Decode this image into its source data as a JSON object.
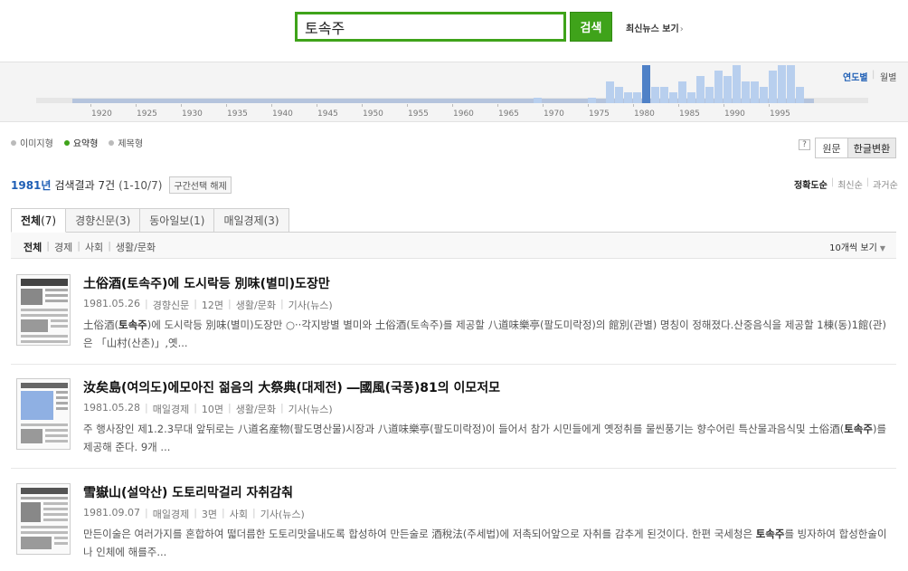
{
  "search": {
    "query": "토속주",
    "button_label": "검색",
    "latest_news_label": "최신뉴스 보기"
  },
  "timeline": {
    "year_toggle": "연도별",
    "month_toggle": "월별",
    "axis_labels": [
      "1920",
      "1925",
      "1930",
      "1935",
      "1940",
      "1945",
      "1950",
      "1955",
      "1960",
      "1965",
      "1970",
      "1975",
      "1980",
      "1985",
      "1990",
      "1995"
    ],
    "selected_year": 1981,
    "bar_color": "#b8cfee",
    "selected_color": "#4f81c7",
    "bars": [
      {
        "year": 1969,
        "value": 1
      },
      {
        "year": 1975,
        "value": 1
      },
      {
        "year": 1977,
        "value": 4
      },
      {
        "year": 1978,
        "value": 3
      },
      {
        "year": 1979,
        "value": 2
      },
      {
        "year": 1980,
        "value": 2
      },
      {
        "year": 1981,
        "value": 7
      },
      {
        "year": 1982,
        "value": 3
      },
      {
        "year": 1983,
        "value": 3
      },
      {
        "year": 1984,
        "value": 2
      },
      {
        "year": 1985,
        "value": 4
      },
      {
        "year": 1986,
        "value": 2
      },
      {
        "year": 1987,
        "value": 5
      },
      {
        "year": 1988,
        "value": 3
      },
      {
        "year": 1989,
        "value": 6
      },
      {
        "year": 1990,
        "value": 5
      },
      {
        "year": 1991,
        "value": 7
      },
      {
        "year": 1992,
        "value": 4
      },
      {
        "year": 1993,
        "value": 4
      },
      {
        "year": 1994,
        "value": 3
      },
      {
        "year": 1995,
        "value": 6
      },
      {
        "year": 1996,
        "value": 7
      },
      {
        "year": 1997,
        "value": 7
      },
      {
        "year": 1998,
        "value": 3
      }
    ]
  },
  "view_options": [
    {
      "label": "이미지형",
      "selected": false
    },
    {
      "label": "요약형",
      "selected": true
    },
    {
      "label": "제목형",
      "selected": false
    }
  ],
  "help_label": "?",
  "text_mode": {
    "original": "원문",
    "hangul": "한글변환"
  },
  "result": {
    "year": "1981년",
    "count_text": "검색결과 7건",
    "range_text": "(1-10/7)",
    "clear_label": "구간선택 해제"
  },
  "sort": {
    "accuracy": "정확도순",
    "newest": "최신순",
    "oldest": "과거순"
  },
  "tabs": [
    {
      "label": "전체",
      "count": "(7)",
      "active": true
    },
    {
      "label": "경향신문",
      "count": "(3)",
      "active": false
    },
    {
      "label": "동아일보",
      "count": "(1)",
      "active": false
    },
    {
      "label": "매일경제",
      "count": "(3)",
      "active": false
    }
  ],
  "subcategories": [
    "전체",
    "경제",
    "사회",
    "생활/문화"
  ],
  "per_page": "10개씩 보기",
  "articles": [
    {
      "title": "土俗酒(토속주)에 도시락등 別味(별미)도장만",
      "date": "1981.05.26",
      "paper": "경향신문",
      "page": "12면",
      "section": "생활/문화",
      "kind": "기사(뉴스)",
      "snippet_pre": "土俗酒(",
      "snippet_kw": "토속주",
      "snippet_post": ")에 도시락등 別味(별미)도장만 ○··각지방별 별미와 土俗酒(토속주)를 제공할 八道味樂亭(팔도미락정)의 館別(관별) 명칭이 정해졌다.산중음식을 제공할 1棟(동)1館(관)은 「山村(산촌)」,옛..."
    },
    {
      "title": "汝矣島(여의도)에모아진 젊음의 大祭典(대제전) ―國風(국풍)81의 이모저모",
      "date": "1981.05.28",
      "paper": "매일경제",
      "page": "10면",
      "section": "생활/문화",
      "kind": "기사(뉴스)",
      "snippet_pre": "주 행사장인 제1.2.3무대 앞뒤로는 八道名産物(팔도명산물)시장과 八道味樂亭(팔도미락정)이 들어서 참가 시민들에게 옛정취를 물씬풍기는 향수어린 특산물과음식및 土俗酒(",
      "snippet_kw": "토속주",
      "snippet_post": ")를 제공해 준다. 9개 ..."
    },
    {
      "title": "雪嶽山(설악산) 도토리막걸리 자취감춰",
      "date": "1981.09.07",
      "paper": "매일경제",
      "page": "3면",
      "section": "사회",
      "kind": "기사(뉴스)",
      "snippet_pre": "만든이술은 여러가지를 혼합하여 떫더름한 도토리맛을내도록 합성하여 만든술로 酒稅法(주세법)에 저촉되어앞으로 자취를 감추게 된것이다. 한편 국세청은 ",
      "snippet_kw": "토속주",
      "snippet_post": "를 빙자하여 합성한술이나 인체에 해를주..."
    }
  ]
}
